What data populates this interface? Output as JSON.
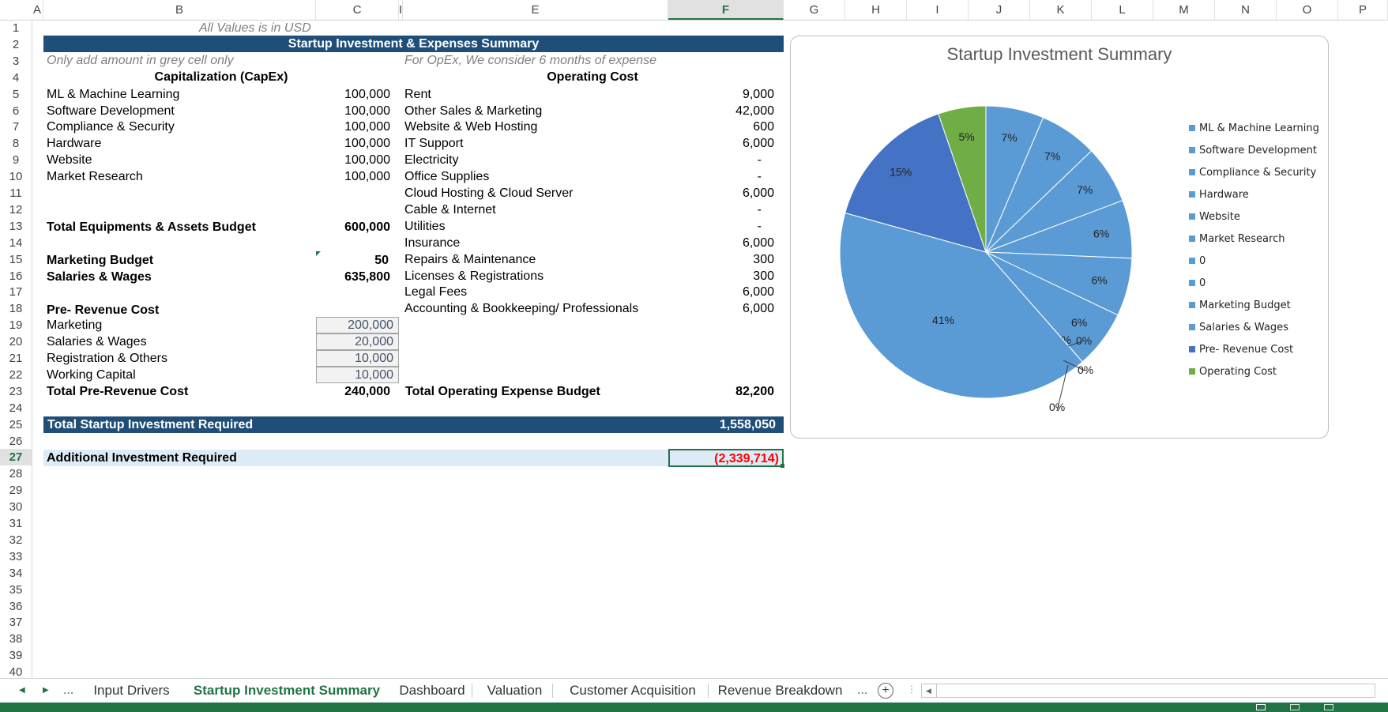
{
  "columns": [
    "A",
    "B",
    "C",
    "I",
    "E",
    "F",
    "G",
    "H",
    "I",
    "J",
    "K",
    "L",
    "M",
    "N",
    "O",
    "P"
  ],
  "rows": [
    "1",
    "2",
    "3",
    "4",
    "5",
    "6",
    "7",
    "8",
    "9",
    "10",
    "11",
    "12",
    "13",
    "14",
    "15",
    "16",
    "17",
    "18",
    "19",
    "20",
    "21",
    "22",
    "23",
    "24",
    "25",
    "26",
    "27",
    "28",
    "29",
    "30",
    "31",
    "32",
    "33",
    "34",
    "35",
    "36",
    "37",
    "38",
    "39",
    "40"
  ],
  "sheet": {
    "note_usd": "All Values is in USD",
    "title": "Startup Investment & Expenses Summary",
    "note_grey": "Only add amount in grey cell only",
    "note_opex": "For OpEx, We consider 6 months of expense",
    "capex_header": "Capitalization (CapEx)",
    "opex_header": "Operating Cost",
    "capex_items": [
      {
        "label": "ML & Machine Learning",
        "value": "100,000"
      },
      {
        "label": "Software Development",
        "value": "100,000"
      },
      {
        "label": "Compliance & Security",
        "value": "100,000"
      },
      {
        "label": "Hardware",
        "value": "100,000"
      },
      {
        "label": "Website",
        "value": "100,000"
      },
      {
        "label": "Market Research",
        "value": "100,000"
      }
    ],
    "opex_items": [
      {
        "label": "Rent",
        "value": "9,000"
      },
      {
        "label": "Other Sales & Marketing",
        "value": "42,000"
      },
      {
        "label": "Website & Web Hosting",
        "value": "600"
      },
      {
        "label": "IT Support",
        "value": "6,000"
      },
      {
        "label": "Electricity",
        "value": "-"
      },
      {
        "label": "Office Supplies",
        "value": "-"
      },
      {
        "label": "Cloud Hosting & Cloud Server",
        "value": "6,000"
      },
      {
        "label": "Cable & Internet",
        "value": "-"
      },
      {
        "label": "Utilities",
        "value": "-"
      },
      {
        "label": "Insurance",
        "value": "6,000"
      },
      {
        "label": "Repairs & Maintenance",
        "value": "300"
      },
      {
        "label": "Licenses & Registrations",
        "value": "300"
      },
      {
        "label": "Legal Fees",
        "value": "6,000"
      },
      {
        "label": "Accounting & Bookkeeping/ Professionals",
        "value": "6,000"
      }
    ],
    "total_equipment_label": "Total Equipments & Assets Budget",
    "total_equipment_value": "600,000",
    "marketing_budget_label": "Marketing Budget",
    "marketing_budget_value": "50",
    "salaries_label": "Salaries & Wages",
    "salaries_value": "635,800",
    "prerev_header": "Pre- Revenue Cost",
    "prerev_items": [
      {
        "label": "Marketing",
        "value": "200,000"
      },
      {
        "label": "Salaries & Wages",
        "value": "20,000"
      },
      {
        "label": "Registration & Others",
        "value": "10,000"
      },
      {
        "label": "Working Capital",
        "value": "10,000"
      }
    ],
    "total_prerev_label": "Total Pre-Revenue Cost",
    "total_prerev_value": "240,000",
    "total_opex_label": "Total Operating Expense Budget",
    "total_opex_value": "82,200",
    "total_startup_label": "Total Startup Investment Required",
    "total_startup_value": "1,558,050",
    "additional_label": "Additional Investment Required",
    "additional_value": "(2,339,714)"
  },
  "chart_data": {
    "type": "pie",
    "title": "Startup Investment Summary",
    "categories": [
      "ML & Machine Learning",
      "Software Development",
      "Compliance & Security",
      "Hardware",
      "Website",
      "Market Research",
      "0",
      "0",
      "Marketing Budget",
      "Salaries & Wages",
      "Pre- Revenue Cost",
      "Operating Cost"
    ],
    "values": [
      100000,
      100000,
      100000,
      100000,
      100000,
      100000,
      0,
      0,
      50,
      635800,
      240000,
      82200
    ],
    "labels": [
      "7%",
      "7%",
      "7%",
      "6%",
      "6%",
      "6%",
      "",
      "",
      "0%",
      "41%",
      "15%",
      "5%"
    ],
    "colors": [
      "#5b9bd5",
      "#5b9bd5",
      "#5b9bd5",
      "#5b9bd5",
      "#5b9bd5",
      "#5b9bd5",
      "#5b9bd5",
      "#5b9bd5",
      "#5b9bd5",
      "#5b9bd5",
      "#4472c4",
      "#70ad47"
    ],
    "extra_zero_labels": [
      "0%",
      "0%",
      "0%"
    ],
    "legend_placement": "right"
  },
  "tabs": [
    {
      "label": "Input Drivers",
      "active": false
    },
    {
      "label": "Startup Investment Summary",
      "active": true
    },
    {
      "label": "Dashboard",
      "active": false
    },
    {
      "label": "Valuation",
      "active": false
    },
    {
      "label": "Customer Acquisition",
      "active": false
    },
    {
      "label": "Revenue Breakdown",
      "active": false
    }
  ],
  "tab_nav": {
    "prev": "◀",
    "next": "▶",
    "more_left": "...",
    "more_right": "...",
    "add": "+"
  }
}
